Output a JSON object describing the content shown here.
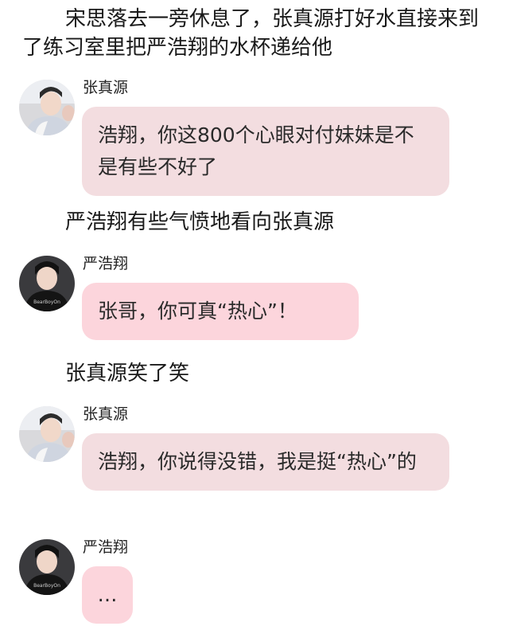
{
  "narration": {
    "intro": "宋思落去一旁休息了，张真源打好水直接来到了练习室里把严浩翔的水杯递给他",
    "line2": "严浩翔有些气愤地看向张真源",
    "line3": "张真源笑了笑"
  },
  "messages": [
    {
      "sender": "张真源",
      "text": "浩翔，你这800个心眼对付妹妹是不是有些不好了",
      "avatar": "zhang-avatar"
    },
    {
      "sender": "严浩翔",
      "text": "张哥，你可真“热心”！",
      "avatar": "yan-avatar"
    },
    {
      "sender": "张真源",
      "text": "浩翔，你说得没错，我是挺“热心”的",
      "avatar": "zhang-avatar"
    },
    {
      "sender": "严浩翔",
      "text": "…",
      "avatar": "yan-avatar"
    }
  ],
  "colors": {
    "bubble_light": "#f3dde0",
    "bubble_pink": "#fcd5dc",
    "background": "#ffffff"
  }
}
